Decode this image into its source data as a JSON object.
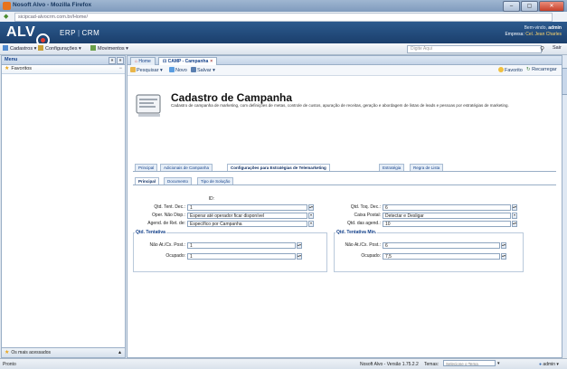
{
  "window": {
    "title": "Nosoft Alvo - Mozilla Firefox",
    "url": "sicipcad-alvocrm.com.br/Home/",
    "buttons": {
      "minimize": "–",
      "maximize": "▢",
      "close": "✕"
    }
  },
  "header": {
    "logo": "ALV",
    "erp": "ERP",
    "sep": "|",
    "crm": "CRM",
    "welcome_prefix": "Bem-vindo,",
    "welcome_user": "admin",
    "empresa_label": "Empresa:",
    "empresa_value": "Cel. Jean Charles"
  },
  "menubar": {
    "items": [
      "Cadastros",
      "Configurações",
      "Movimentos"
    ],
    "search_placeholder": "Digite Aqui",
    "logout": "Sair"
  },
  "sidebar": {
    "title": "Menu",
    "favorites": "Favoritos",
    "footer": "Os mais acessados"
  },
  "tabs": {
    "home": "Home",
    "active": "CAMP - Campanha"
  },
  "toolbar": {
    "search": "Pesquisar",
    "new": "Novo",
    "save": "Salvar",
    "favorite": "Favorito",
    "reload": "Recarregar"
  },
  "page": {
    "title": "Cadastro de Campanha",
    "description": "Cadastro de campanha de marketing, com definições de metas, controle de custos, apuração de receitas, geração e abordagem de listas de leads e pessoas por estratégias de marketing."
  },
  "section_tabs": [
    "Principal",
    "Adicionais de Campanha",
    "Configurações para Estratégias de Telemarketing",
    "Estratégia",
    "Regra de Lista"
  ],
  "sub_tabs": [
    "Principal",
    "Documento",
    "Tipo de Solução"
  ],
  "form": {
    "id_label": "ID:",
    "left": {
      "tent_label": "Qtd. Tent. Dec.:",
      "tent_value": "1",
      "oper_label": "Oper. Não Disp.:",
      "oper_value": "Esperar até operador ficar disponível",
      "agend_label": "Agend. de Ret. de:",
      "agend_value": "Específico por Campanha"
    },
    "right": {
      "toq_label": "Qtd. Toq. Dec.:",
      "toq_value": "6",
      "caixa_label": "Caixa Postal:",
      "caixa_value": "Detectar e Desligar",
      "agend_label": "Qtd. das agend.:",
      "agend_value": "10"
    },
    "tentativa": {
      "legend": "Qtd. Tentativa",
      "nao_label": "Não At./Cx. Post.:",
      "nao_value": "1",
      "ocup_label": "Ocupado:",
      "ocup_value": "1"
    },
    "tentativa_min": {
      "legend": "Qtd. Tentativa Min.",
      "nao_label": "Não At./Cx. Post.:",
      "nao_value": "6",
      "ocup_label": "Ocupado:",
      "ocup_value": "7,5"
    }
  },
  "status": {
    "ready": "Pronto",
    "version": "Nosoft Alvo - Versão 1.75.2.2",
    "temas_label": "Temas:",
    "temas_value": "Selecione o Tema",
    "user": "admin"
  },
  "colors": {
    "header_bg": "#1b3f6c",
    "logo_accent": "#e43a2f",
    "link": "#15428b"
  }
}
